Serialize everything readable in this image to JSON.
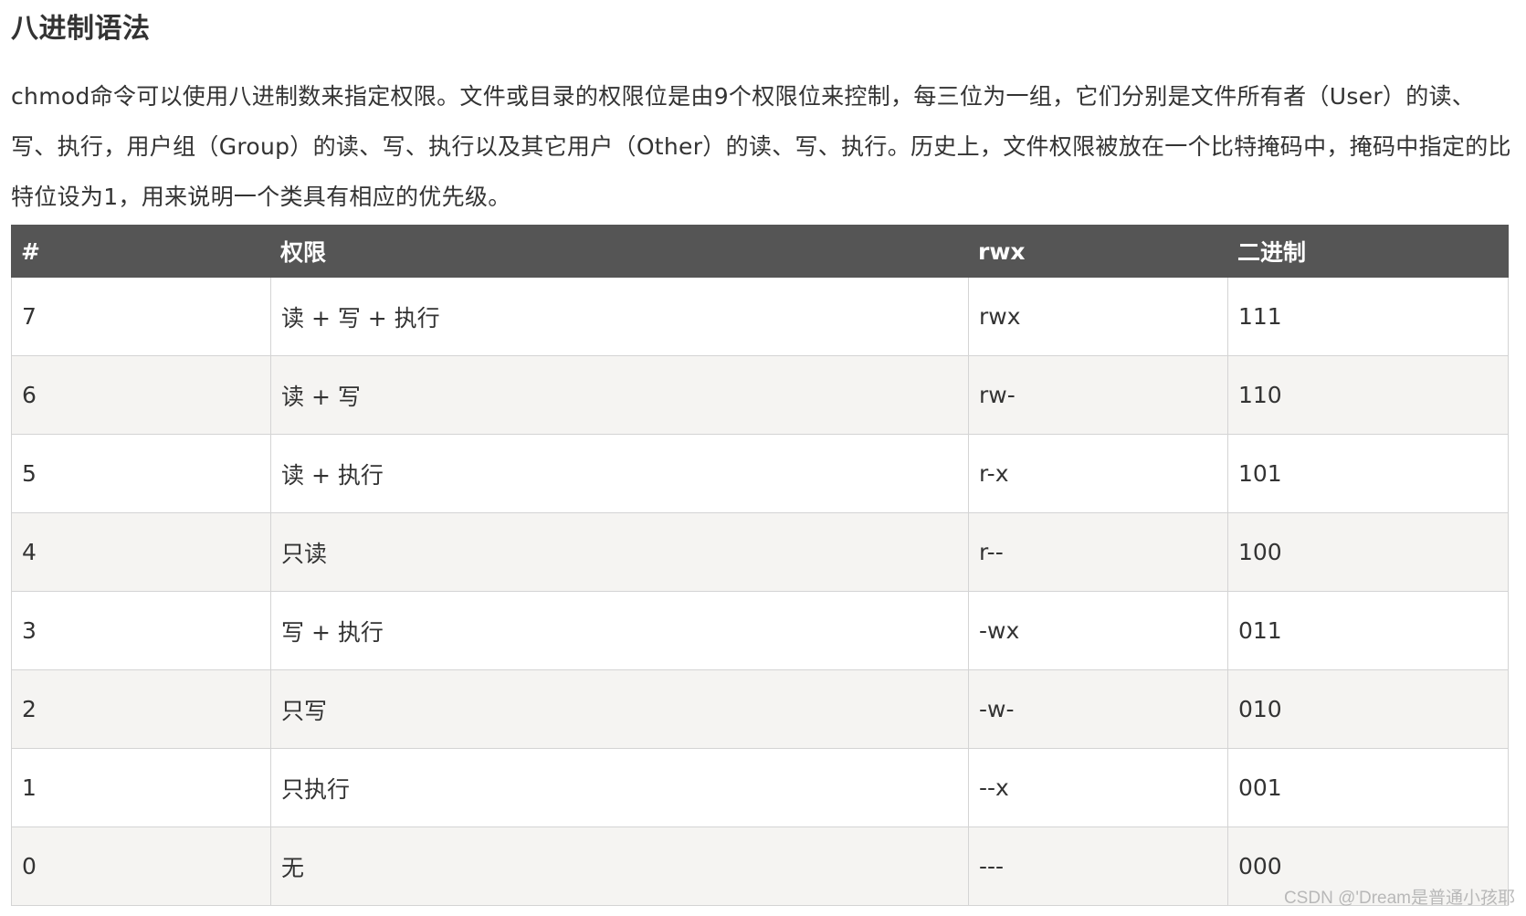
{
  "heading": "八进制语法",
  "intro": "chmod命令可以使用八进制数来指定权限。文件或目录的权限位是由9个权限位来控制，每三位为一组，它们分别是文件所有者（User）的读、写、执行，用户组（Group）的读、写、执行以及其它用户（Other）的读、写、执行。历史上，文件权限被放在一个比特掩码中，掩码中指定的比特位设为1，用来说明一个类具有相应的优先级。",
  "table": {
    "headers": [
      "#",
      "权限",
      "rwx",
      "二进制"
    ],
    "rows": [
      [
        "7",
        "读 + 写 + 执行",
        "rwx",
        "111"
      ],
      [
        "6",
        "读 + 写",
        "rw-",
        "110"
      ],
      [
        "5",
        "读 + 执行",
        "r-x",
        "101"
      ],
      [
        "4",
        "只读",
        "r--",
        "100"
      ],
      [
        "3",
        "写 + 执行",
        "-wx",
        "011"
      ],
      [
        "2",
        "只写",
        "-w-",
        "010"
      ],
      [
        "1",
        "只执行",
        "--x",
        "001"
      ],
      [
        "0",
        "无",
        "---",
        "000"
      ]
    ]
  },
  "watermark": "CSDN @'Dream是普通小孩耶",
  "colors": {
    "header_bg": "#555555",
    "header_text": "#ffffff",
    "row_alt_bg": "#f5f4f2",
    "border": "#d4d4d4"
  }
}
